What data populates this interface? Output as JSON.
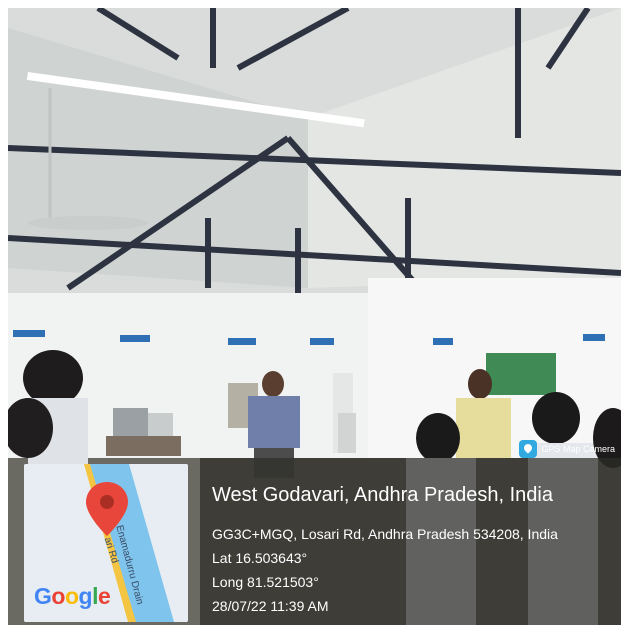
{
  "camera_badge": {
    "label": "GPS Map Camera",
    "icon": "gps-map-camera-icon"
  },
  "location": {
    "title": "West Godavari, Andhra Pradesh, India",
    "address": "GG3C+MGQ, Losari Rd, Andhra Pradesh 534208, India",
    "latitude": "Lat 16.503643°",
    "longitude": "Long 81.521503°",
    "timestamp": "28/07/22 11:39 AM"
  },
  "map": {
    "road_labels": [
      "Enamadurru Drain",
      "ari Rd"
    ],
    "logo": "Google",
    "pin_icon": "location-pin-icon"
  },
  "colors": {
    "overlay": "#2d2d28",
    "pin": "#e8463a",
    "canal": "#7fc4ec",
    "road": "#f4c542"
  }
}
